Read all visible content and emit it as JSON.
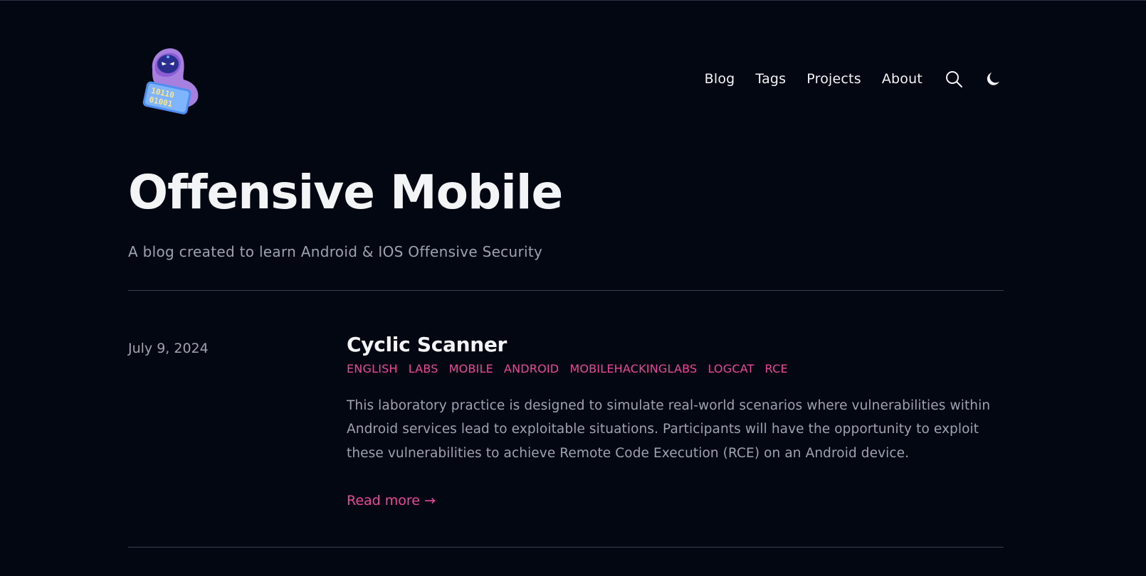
{
  "nav": {
    "items": [
      {
        "label": "Blog"
      },
      {
        "label": "Tags"
      },
      {
        "label": "Projects"
      },
      {
        "label": "About"
      }
    ],
    "search_icon": "search-icon",
    "theme_icon": "moon-icon"
  },
  "hero": {
    "title": "Offensive Mobile",
    "subtitle": "A blog created to learn Android & IOS Offensive Security"
  },
  "posts": [
    {
      "date": "July 9, 2024",
      "title": "Cyclic Scanner",
      "tags": [
        "ENGLISH",
        "LABS",
        "MOBILE",
        "ANDROID",
        "MOBILEHACKINGLABS",
        "LOGCAT",
        "RCE"
      ],
      "summary": "This laboratory practice is designed to simulate real-world scenarios where vulnerabilities within Android services lead to exploitable situations. Participants will have the opportunity to exploit these vulnerabilities to achieve Remote Code Execution (RCE) on an Android device.",
      "read_more": "Read more →"
    }
  ],
  "colors": {
    "background": "#030712",
    "accent": "#ec4899",
    "text": "#f3f4f6",
    "muted": "#9ca3af"
  }
}
